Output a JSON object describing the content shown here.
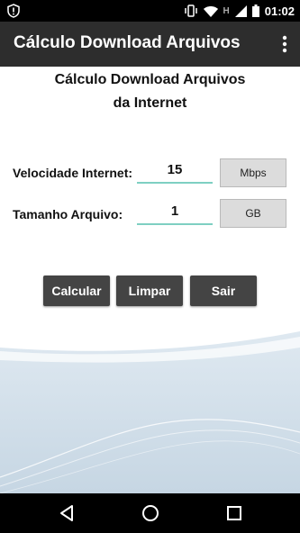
{
  "status_bar": {
    "time": "01:02",
    "network_letter": "H",
    "icons": [
      "shield-icon",
      "vibrate-icon",
      "wifi-icon",
      "signal-icon",
      "battery-icon"
    ]
  },
  "app_bar": {
    "title": "Cálculo Download Arquivos",
    "menu_icon": "more-vert-icon"
  },
  "heading": {
    "line1": "Cálculo Download Arquivos",
    "line2": "da Internet"
  },
  "form": {
    "speed": {
      "label": "Velocidade Internet:",
      "value": "15",
      "unit": "Mbps"
    },
    "size": {
      "label": "Tamanho Arquivo:",
      "value": "1",
      "unit": "GB"
    }
  },
  "buttons": {
    "calculate": "Calcular",
    "clear": "Limpar",
    "exit": "Sair"
  },
  "nav_bar": {
    "icons": [
      "back-icon",
      "home-icon",
      "recents-icon"
    ]
  },
  "colors": {
    "app_bar": "#2d2d2d",
    "button": "#444444",
    "field_underline": "#7ecfc2",
    "unit_button": "#dcdcdc"
  }
}
